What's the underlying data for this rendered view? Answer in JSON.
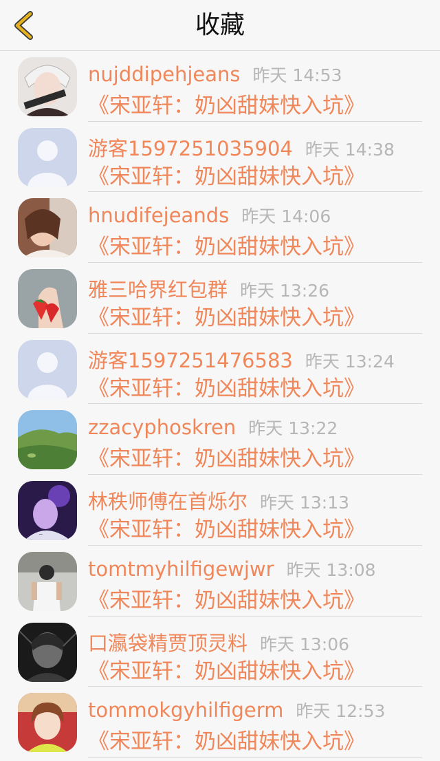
{
  "nav": {
    "title": "收藏",
    "back_icon": "chevron-left-icon",
    "accent": "#e6b220"
  },
  "colors": {
    "username": "#f0875a",
    "time": "#b6b6b6",
    "background": "#f7f7f7"
  },
  "items": [
    {
      "avatar": "anime-character-avatar",
      "username": "nujddipehjeans",
      "time": "昨天 14:53",
      "title": "《宋亚轩：奶凶甜妹快入坑》"
    },
    {
      "avatar": "default-user-avatar",
      "username": "游客1597251035904",
      "time": "昨天 14:38",
      "title": "《宋亚轩：奶凶甜妹快入坑》"
    },
    {
      "avatar": "girl-photo-avatar",
      "username": "hnudifejeands",
      "time": "昨天 14:06",
      "title": "《宋亚轩：奶凶甜妹快入坑》"
    },
    {
      "avatar": "strawberry-avatar",
      "username": "雅三哈界红包群",
      "time": "昨天 13:26",
      "title": "《宋亚轩：奶凶甜妹快入坑》"
    },
    {
      "avatar": "default-user-avatar",
      "username": "游客1597251476583",
      "time": "昨天 13:24",
      "title": "《宋亚轩：奶凶甜妹快入坑》"
    },
    {
      "avatar": "landscape-avatar",
      "username": "zzacyphoskren",
      "time": "昨天 13:22",
      "title": "《宋亚轩：奶凶甜妹快入坑》"
    },
    {
      "avatar": "purple-photo-avatar",
      "username": "林秩师傅在首烁尔",
      "time": "昨天 13:13",
      "title": "《宋亚轩：奶凶甜妹快入坑》"
    },
    {
      "avatar": "person-back-avatar",
      "username": "tomtmyhilfigewjwr",
      "time": "昨天 13:08",
      "title": "《宋亚轩：奶凶甜妹快入坑》"
    },
    {
      "avatar": "dark-photo-avatar",
      "username": "口瀛袋精贾顶灵料",
      "time": "昨天 13:06",
      "title": "《宋亚轩：奶凶甜妹快入坑》"
    },
    {
      "avatar": "girl-selfie-avatar",
      "username": "tommokgyhilfigerm",
      "time": "昨天 12:53",
      "title": "《宋亚轩：奶凶甜妹快入坑》"
    }
  ]
}
